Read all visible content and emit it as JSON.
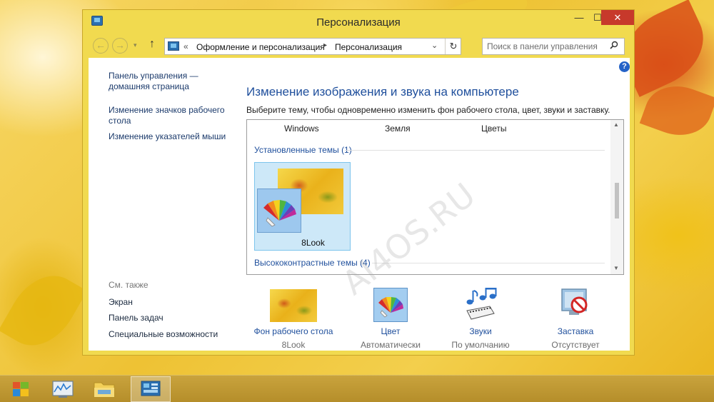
{
  "window": {
    "title": "Персонализация",
    "controls": {
      "minimize": "—",
      "maximize": "☐",
      "close": "✕"
    }
  },
  "navigation": {
    "back": "←",
    "forward": "→",
    "recent": "▾",
    "up": "↑",
    "breadcrumb_overflow": "«",
    "breadcrumb": [
      "Оформление и персонализация",
      "Персонализация"
    ],
    "separator": "▸",
    "dropdown": "⌄",
    "refresh": "↻"
  },
  "search": {
    "placeholder": "Поиск в панели управления"
  },
  "help": "?",
  "sidebar": {
    "links": [
      "Панель управления — домашняя страница",
      "Изменение значков рабочего стола",
      "Изменение указателей мыши"
    ],
    "see_also_label": "См. также",
    "see_also": [
      "Экран",
      "Панель задач",
      "Специальные возможности"
    ]
  },
  "main": {
    "title": "Изменение изображения и звука на компьютере",
    "description": "Выберите тему, чтобы одновременно изменить фон рабочего стола, цвет, звуки и заставку."
  },
  "themes": {
    "top_row": [
      "Windows",
      "Земля",
      "Цветы"
    ],
    "groups": [
      {
        "label": "Установленные темы (1)",
        "items": [
          {
            "name": "8Look",
            "selected": true
          }
        ]
      },
      {
        "label": "Высококонтрастные темы (4)",
        "items": []
      }
    ]
  },
  "scrollbar": {
    "up": "▲",
    "down": "▼"
  },
  "watermark": "AI4OS.RU",
  "quick_settings": [
    {
      "label": "Фон рабочего стола",
      "value": "8Look",
      "icon": "wallpaper-icon"
    },
    {
      "label": "Цвет",
      "value": "Автоматически",
      "icon": "color-palette-icon"
    },
    {
      "label": "Звуки",
      "value": "По умолчанию",
      "icon": "sound-notes-icon"
    },
    {
      "label": "Заставка",
      "value": "Отсутствует",
      "icon": "screensaver-icon"
    }
  ],
  "taskbar": {
    "items": [
      "start-button",
      "performance-monitor",
      "file-explorer",
      "control-panel"
    ]
  },
  "colors": {
    "link": "#1f4f9c",
    "window_frame": "#f1da4f",
    "close_button": "#c7392b",
    "selection": "#cde8f8"
  }
}
